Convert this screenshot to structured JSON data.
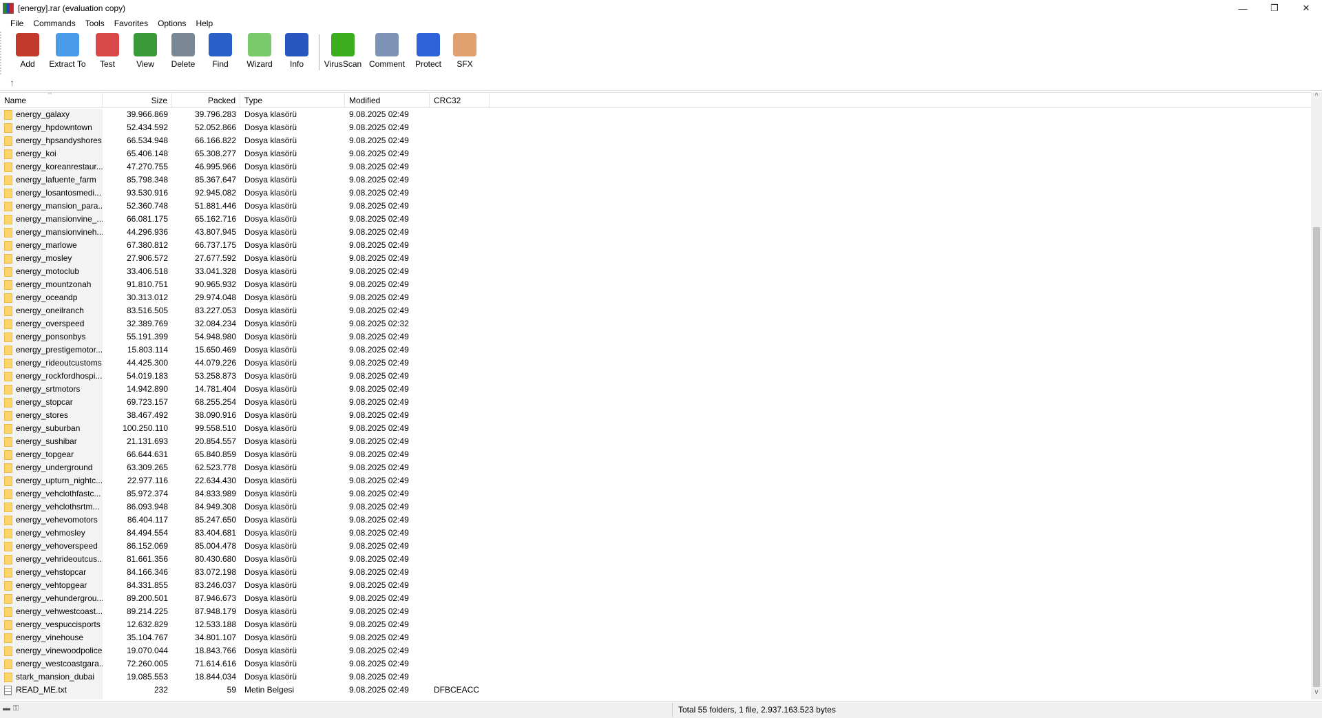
{
  "window": {
    "title": "[energy].rar (evaluation copy)",
    "minimize": "—",
    "restore": "❐",
    "close": "✕"
  },
  "menu": [
    "File",
    "Commands",
    "Tools",
    "Favorites",
    "Options",
    "Help"
  ],
  "toolbar": [
    {
      "label": "Add",
      "icon": "add-archive-icon",
      "color": "#c0392b"
    },
    {
      "label": "Extract To",
      "icon": "extract-folder-icon",
      "color": "#4a9be8"
    },
    {
      "label": "Test",
      "icon": "test-clipboard-icon",
      "color": "#d94848"
    },
    {
      "label": "View",
      "icon": "view-book-icon",
      "color": "#3a9a3a"
    },
    {
      "label": "Delete",
      "icon": "trash-icon",
      "color": "#7a8794"
    },
    {
      "label": "Find",
      "icon": "magnifier-icon",
      "color": "#2a5fc8"
    },
    {
      "label": "Wizard",
      "icon": "wizard-wand-icon",
      "color": "#7ac96a"
    },
    {
      "label": "Info",
      "icon": "info-icon",
      "color": "#2a56c0"
    },
    {
      "label": "VirusScan",
      "icon": "virus-scan-icon",
      "color": "#3cae1e"
    },
    {
      "label": "Comment",
      "icon": "comment-icon",
      "color": "#7d93b5"
    },
    {
      "label": "Protect",
      "icon": "shield-icon",
      "color": "#2e62d8"
    },
    {
      "label": "SFX",
      "icon": "sfx-box-icon",
      "color": "#e0a070"
    }
  ],
  "columns": [
    "Name",
    "Size",
    "Packed",
    "Type",
    "Modified",
    "CRC32"
  ],
  "rows": [
    [
      "energy_galaxy",
      "39.966.869",
      "39.796.283",
      "Dosya klasörü",
      "9.08.2025 02:49",
      ""
    ],
    [
      "energy_hpdowntown",
      "52.434.592",
      "52.052.866",
      "Dosya klasörü",
      "9.08.2025 02:49",
      ""
    ],
    [
      "energy_hpsandyshores",
      "66.534.948",
      "66.166.822",
      "Dosya klasörü",
      "9.08.2025 02:49",
      ""
    ],
    [
      "energy_koi",
      "65.406.148",
      "65.308.277",
      "Dosya klasörü",
      "9.08.2025 02:49",
      ""
    ],
    [
      "energy_koreanrestaur...",
      "47.270.755",
      "46.995.966",
      "Dosya klasörü",
      "9.08.2025 02:49",
      ""
    ],
    [
      "energy_lafuente_farm",
      "85.798.348",
      "85.367.647",
      "Dosya klasörü",
      "9.08.2025 02:49",
      ""
    ],
    [
      "energy_losantosmedi...",
      "93.530.916",
      "92.945.082",
      "Dosya klasörü",
      "9.08.2025 02:49",
      ""
    ],
    [
      "energy_mansion_para...",
      "52.360.748",
      "51.881.446",
      "Dosya klasörü",
      "9.08.2025 02:49",
      ""
    ],
    [
      "energy_mansionvine_...",
      "66.081.175",
      "65.162.716",
      "Dosya klasörü",
      "9.08.2025 02:49",
      ""
    ],
    [
      "energy_mansionvineh...",
      "44.296.936",
      "43.807.945",
      "Dosya klasörü",
      "9.08.2025 02:49",
      ""
    ],
    [
      "energy_marlowe",
      "67.380.812",
      "66.737.175",
      "Dosya klasörü",
      "9.08.2025 02:49",
      ""
    ],
    [
      "energy_mosley",
      "27.906.572",
      "27.677.592",
      "Dosya klasörü",
      "9.08.2025 02:49",
      ""
    ],
    [
      "energy_motoclub",
      "33.406.518",
      "33.041.328",
      "Dosya klasörü",
      "9.08.2025 02:49",
      ""
    ],
    [
      "energy_mountzonah",
      "91.810.751",
      "90.965.932",
      "Dosya klasörü",
      "9.08.2025 02:49",
      ""
    ],
    [
      "energy_oceandp",
      "30.313.012",
      "29.974.048",
      "Dosya klasörü",
      "9.08.2025 02:49",
      ""
    ],
    [
      "energy_oneilranch",
      "83.516.505",
      "83.227.053",
      "Dosya klasörü",
      "9.08.2025 02:49",
      ""
    ],
    [
      "energy_overspeed",
      "32.389.769",
      "32.084.234",
      "Dosya klasörü",
      "9.08.2025 02:32",
      ""
    ],
    [
      "energy_ponsonbys",
      "55.191.399",
      "54.948.980",
      "Dosya klasörü",
      "9.08.2025 02:49",
      ""
    ],
    [
      "energy_prestigemotor...",
      "15.803.114",
      "15.650.469",
      "Dosya klasörü",
      "9.08.2025 02:49",
      ""
    ],
    [
      "energy_rideoutcustoms",
      "44.425.300",
      "44.079.226",
      "Dosya klasörü",
      "9.08.2025 02:49",
      ""
    ],
    [
      "energy_rockfordhospi...",
      "54.019.183",
      "53.258.873",
      "Dosya klasörü",
      "9.08.2025 02:49",
      ""
    ],
    [
      "energy_srtmotors",
      "14.942.890",
      "14.781.404",
      "Dosya klasörü",
      "9.08.2025 02:49",
      ""
    ],
    [
      "energy_stopcar",
      "69.723.157",
      "68.255.254",
      "Dosya klasörü",
      "9.08.2025 02:49",
      ""
    ],
    [
      "energy_stores",
      "38.467.492",
      "38.090.916",
      "Dosya klasörü",
      "9.08.2025 02:49",
      ""
    ],
    [
      "energy_suburban",
      "100.250.110",
      "99.558.510",
      "Dosya klasörü",
      "9.08.2025 02:49",
      ""
    ],
    [
      "energy_sushibar",
      "21.131.693",
      "20.854.557",
      "Dosya klasörü",
      "9.08.2025 02:49",
      ""
    ],
    [
      "energy_topgear",
      "66.644.631",
      "65.840.859",
      "Dosya klasörü",
      "9.08.2025 02:49",
      ""
    ],
    [
      "energy_underground",
      "63.309.265",
      "62.523.778",
      "Dosya klasörü",
      "9.08.2025 02:49",
      ""
    ],
    [
      "energy_upturn_nightc...",
      "22.977.116",
      "22.634.430",
      "Dosya klasörü",
      "9.08.2025 02:49",
      ""
    ],
    [
      "energy_vehclothfastc...",
      "85.972.374",
      "84.833.989",
      "Dosya klasörü",
      "9.08.2025 02:49",
      ""
    ],
    [
      "energy_vehclothsrtm...",
      "86.093.948",
      "84.949.308",
      "Dosya klasörü",
      "9.08.2025 02:49",
      ""
    ],
    [
      "energy_vehevomotors",
      "86.404.117",
      "85.247.650",
      "Dosya klasörü",
      "9.08.2025 02:49",
      ""
    ],
    [
      "energy_vehmosley",
      "84.494.554",
      "83.404.681",
      "Dosya klasörü",
      "9.08.2025 02:49",
      ""
    ],
    [
      "energy_vehoverspeed",
      "86.152.069",
      "85.004.478",
      "Dosya klasörü",
      "9.08.2025 02:49",
      ""
    ],
    [
      "energy_vehrideoutcus...",
      "81.661.356",
      "80.430.680",
      "Dosya klasörü",
      "9.08.2025 02:49",
      ""
    ],
    [
      "energy_vehstopcar",
      "84.166.346",
      "83.072.198",
      "Dosya klasörü",
      "9.08.2025 02:49",
      ""
    ],
    [
      "energy_vehtopgear",
      "84.331.855",
      "83.246.037",
      "Dosya klasörü",
      "9.08.2025 02:49",
      ""
    ],
    [
      "energy_vehundergrou...",
      "89.200.501",
      "87.946.673",
      "Dosya klasörü",
      "9.08.2025 02:49",
      ""
    ],
    [
      "energy_vehwestcoast...",
      "89.214.225",
      "87.948.179",
      "Dosya klasörü",
      "9.08.2025 02:49",
      ""
    ],
    [
      "energy_vespuccisports",
      "12.632.829",
      "12.533.188",
      "Dosya klasörü",
      "9.08.2025 02:49",
      ""
    ],
    [
      "energy_vinehouse",
      "35.104.767",
      "34.801.107",
      "Dosya klasörü",
      "9.08.2025 02:49",
      ""
    ],
    [
      "energy_vinewoodpolice",
      "19.070.044",
      "18.843.766",
      "Dosya klasörü",
      "9.08.2025 02:49",
      ""
    ],
    [
      "energy_westcoastgara...",
      "72.260.005",
      "71.614.616",
      "Dosya klasörü",
      "9.08.2025 02:49",
      ""
    ],
    [
      "stark_mansion_dubai",
      "19.085.553",
      "18.844.034",
      "Dosya klasörü",
      "9.08.2025 02:49",
      ""
    ],
    [
      "READ_ME.txt",
      "232",
      "59",
      "Metin Belgesi",
      "9.08.2025 02:49",
      "DFBCEACC"
    ]
  ],
  "status": {
    "summary": "Total 55 folders, 1 file, 2.937.163.523 bytes"
  }
}
